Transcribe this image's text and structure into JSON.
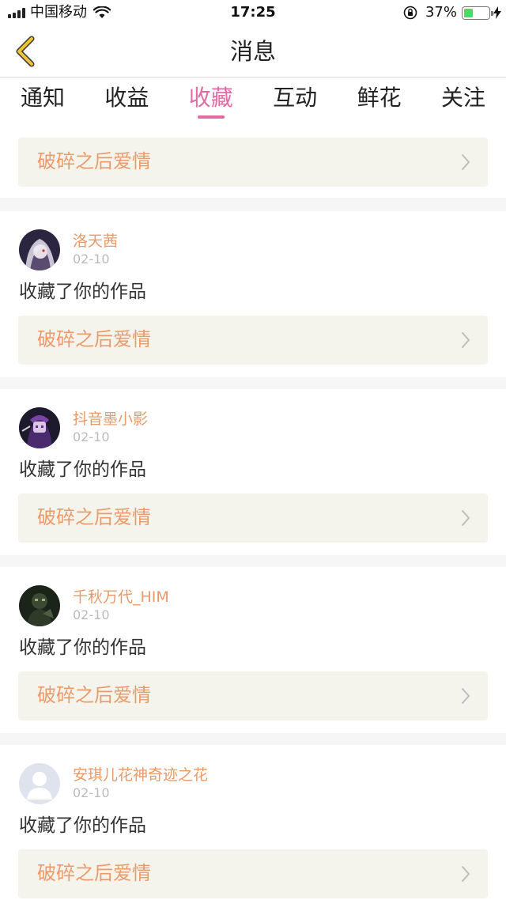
{
  "status_bar": {
    "carrier": "中国移动",
    "time": "17:25",
    "battery": "37%",
    "battery_level": 0.37
  },
  "nav": {
    "title": "消息"
  },
  "tabs": [
    {
      "label": "通知",
      "active": false
    },
    {
      "label": "收益",
      "active": false
    },
    {
      "label": "收藏",
      "active": true
    },
    {
      "label": "互动",
      "active": false
    },
    {
      "label": "鲜花",
      "active": false
    },
    {
      "label": "关注",
      "active": false
    }
  ],
  "feed": {
    "partial_card": {
      "work_title": "破碎之后爱情"
    },
    "items": [
      {
        "username": "洛天茜",
        "date": "02-10",
        "action": "收藏了你的作品",
        "work_title": "破碎之后爱情",
        "avatar": "anime-girl-avatar"
      },
      {
        "username": "抖音墨小影",
        "date": "02-10",
        "action": "收藏了你的作品",
        "work_title": "破碎之后爱情",
        "avatar": "anime-character-avatar"
      },
      {
        "username": "千秋万代_HIM",
        "date": "02-10",
        "action": "收藏了你的作品",
        "work_title": "破碎之后爱情",
        "avatar": "dark-figure-avatar"
      },
      {
        "username": "安琪儿花神奇迹之花",
        "date": "02-10",
        "action": "收藏了你的作品",
        "work_title": "破碎之后爱情",
        "avatar": "default-user-avatar"
      }
    ]
  },
  "colors": {
    "accent_pink": "#e469a5",
    "username_orange": "#e79a6a",
    "work_title_orange": "#ea9b6c",
    "work_box_bg": "#f4f4ec",
    "back_arrow": "#f0c534"
  }
}
